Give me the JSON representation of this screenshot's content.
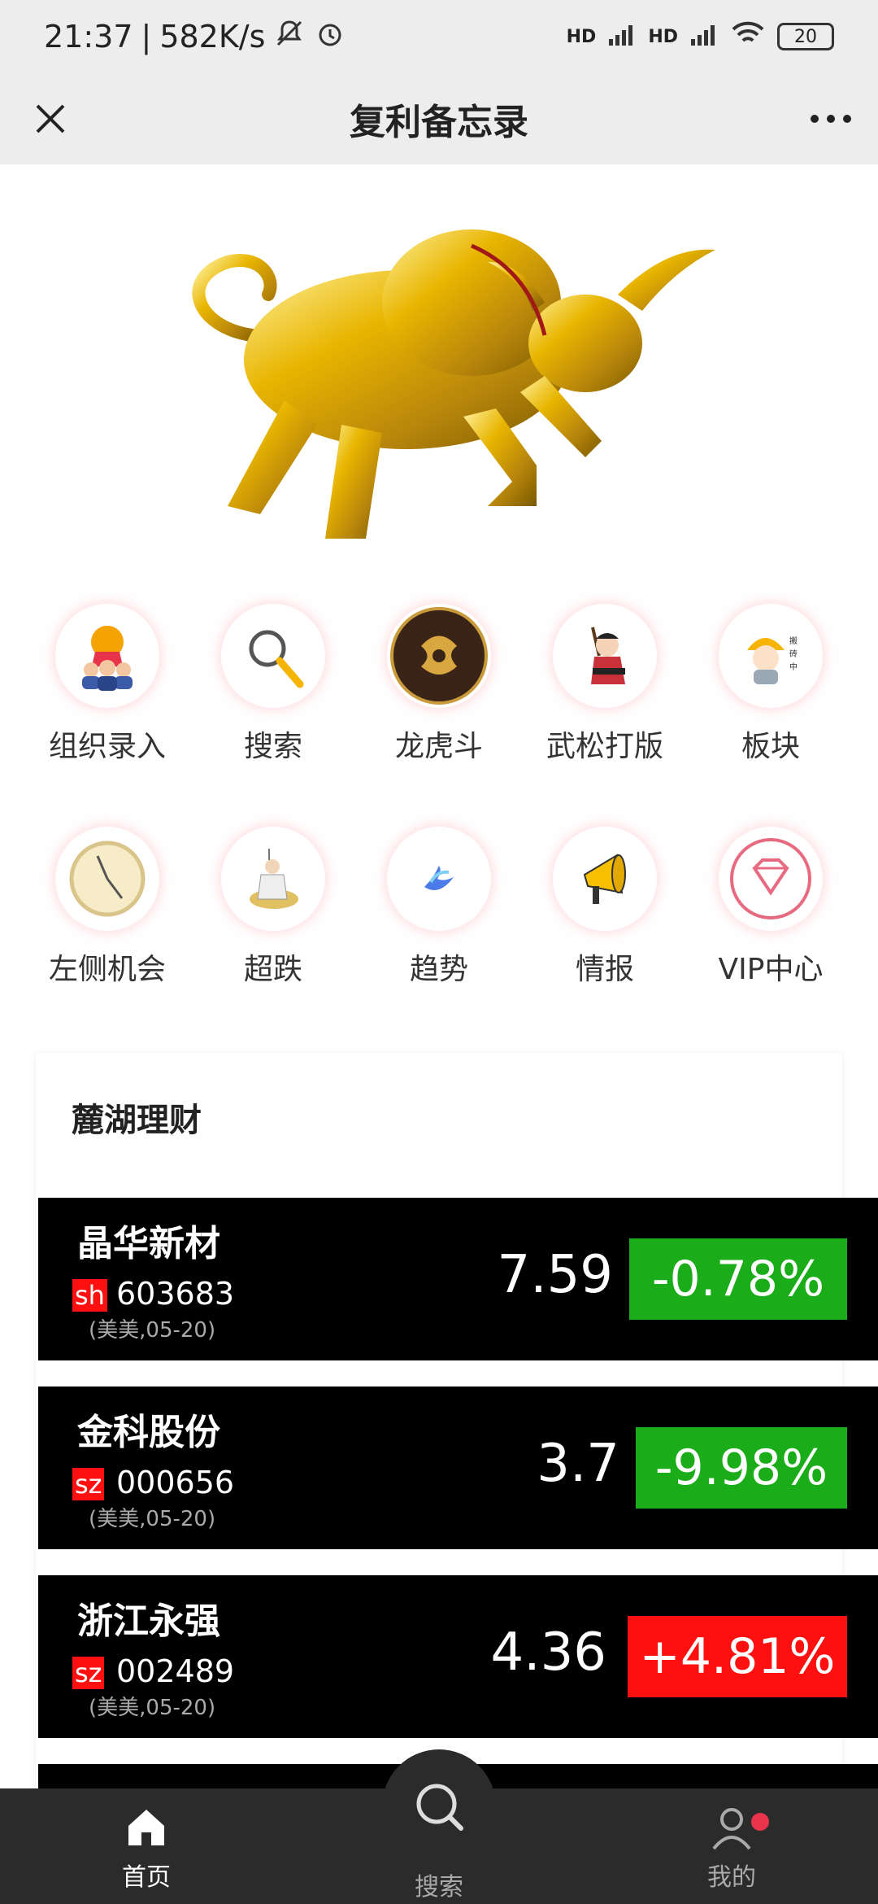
{
  "status_bar": {
    "time": "21:37",
    "speed": "582K/s",
    "battery": "20",
    "signal_label": "HD"
  },
  "title_bar": {
    "title": "复利备忘录",
    "close_icon": "close-icon",
    "more_icon": "more-icon"
  },
  "banner": {
    "icon": "golden-bull-icon"
  },
  "grid": {
    "row1": [
      {
        "label": "组织录入",
        "icon": "medal-people-icon"
      },
      {
        "label": "搜索",
        "icon": "magnifier-icon"
      },
      {
        "label": "龙虎斗",
        "icon": "dragon-tiger-icon"
      },
      {
        "label": "武松打版",
        "icon": "warrior-icon"
      },
      {
        "label": "板块",
        "icon": "worker-icon"
      }
    ],
    "row2": [
      {
        "label": "左侧机会",
        "icon": "clock-icon"
      },
      {
        "label": "超跌",
        "icon": "sage-icon"
      },
      {
        "label": "趋势",
        "icon": "bird-icon"
      },
      {
        "label": "情报",
        "icon": "megaphone-icon"
      },
      {
        "label": "VIP中心",
        "icon": "diamond-icon"
      }
    ]
  },
  "panel": {
    "title": "麓湖理财",
    "stocks": [
      {
        "name": "晶华新材",
        "exchange": "sh",
        "code": "603683",
        "note": "(美美,05-20)",
        "price": "7.59",
        "change": "-0.78%",
        "change_color": "#1aad19"
      },
      {
        "name": "金科股份",
        "exchange": "sz",
        "code": "000656",
        "note": "(美美,05-20)",
        "price": "3.7",
        "change": "-9.98%",
        "change_color": "#1aad19"
      },
      {
        "name": "浙江永强",
        "exchange": "sz",
        "code": "002489",
        "note": "(美美,05-20)",
        "price": "4.36",
        "change": "+4.81%",
        "change_color": "#ff1010"
      }
    ]
  },
  "bottom_nav": {
    "home": "首页",
    "search": "搜索",
    "mine": "我的"
  },
  "colors": {
    "accent_red": "#ff1010",
    "accent_green": "#1aad19",
    "nav_bg": "#2b2b2b"
  }
}
